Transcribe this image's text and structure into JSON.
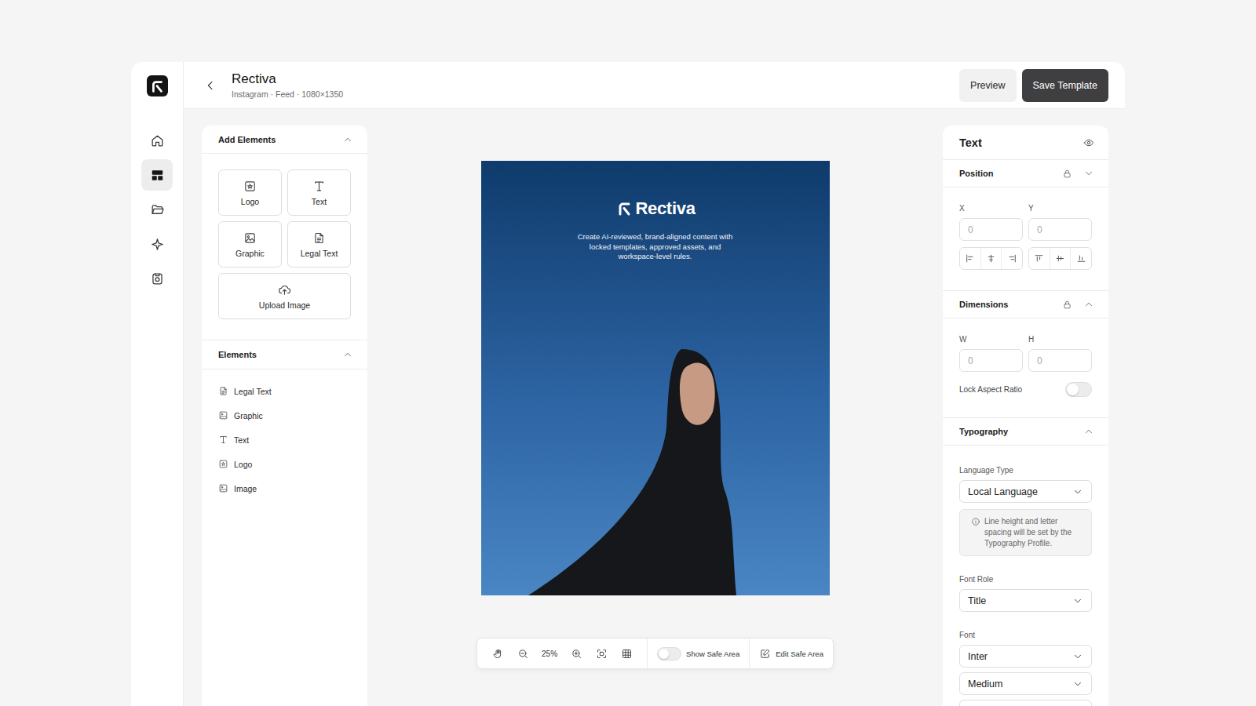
{
  "app": {
    "title": "Rectiva",
    "subtitle": "Instagram · Feed · 1080×1350"
  },
  "nav": [
    {
      "selected": false
    },
    {
      "selected": true
    },
    {
      "selected": false
    },
    {
      "selected": false
    },
    {
      "selected": false
    }
  ],
  "header_buttons": [
    {
      "label": "Preview",
      "kind": "secondary"
    },
    {
      "label": "Save Template",
      "kind": "primary"
    }
  ],
  "add_elements": {
    "title": "Add Elements",
    "expanded": true,
    "items": [
      "Logo",
      "Text",
      "Graphic",
      "Legal Text",
      "Upload Image"
    ]
  },
  "elements": {
    "title": "Elements",
    "expanded": true,
    "items": [
      "Legal Text",
      "Graphic",
      "Text",
      "Logo",
      "Image"
    ]
  },
  "canvas": {
    "logo": "Rectiva",
    "tagline": "Create AI-reviewed, brand-aligned content with locked templates, approved assets, and workspace-level rules."
  },
  "toolbar": {
    "zoom": "25%",
    "show_safe_area": {
      "label": "Show Safe Area",
      "on": false
    },
    "edit_safe_area": "Edit Safe Area"
  },
  "inspector": {
    "title": "Text",
    "position": {
      "title": "Position",
      "locked": true,
      "expanded": false,
      "fields": [
        {
          "label": "X",
          "placeholder": "0"
        },
        {
          "label": "Y",
          "placeholder": "0"
        }
      ]
    },
    "dimensions": {
      "title": "Dimensions",
      "locked": true,
      "expanded": true,
      "fields": [
        {
          "label": "W",
          "placeholder": "0"
        },
        {
          "label": "H",
          "placeholder": "0"
        }
      ],
      "lock_aspect_ratio": {
        "label": "Lock Aspect Ratio",
        "on": false
      }
    },
    "typography": {
      "title": "Typography",
      "expanded": true,
      "language_type": {
        "label": "Language Type",
        "value": "Local Language"
      },
      "note": "Line height and letter spacing will be set by the Typography Profile.",
      "font_role": {
        "label": "Font Role",
        "value": "Title"
      },
      "font": {
        "label": "Font",
        "value": "Inter",
        "weight": "Medium"
      }
    }
  }
}
